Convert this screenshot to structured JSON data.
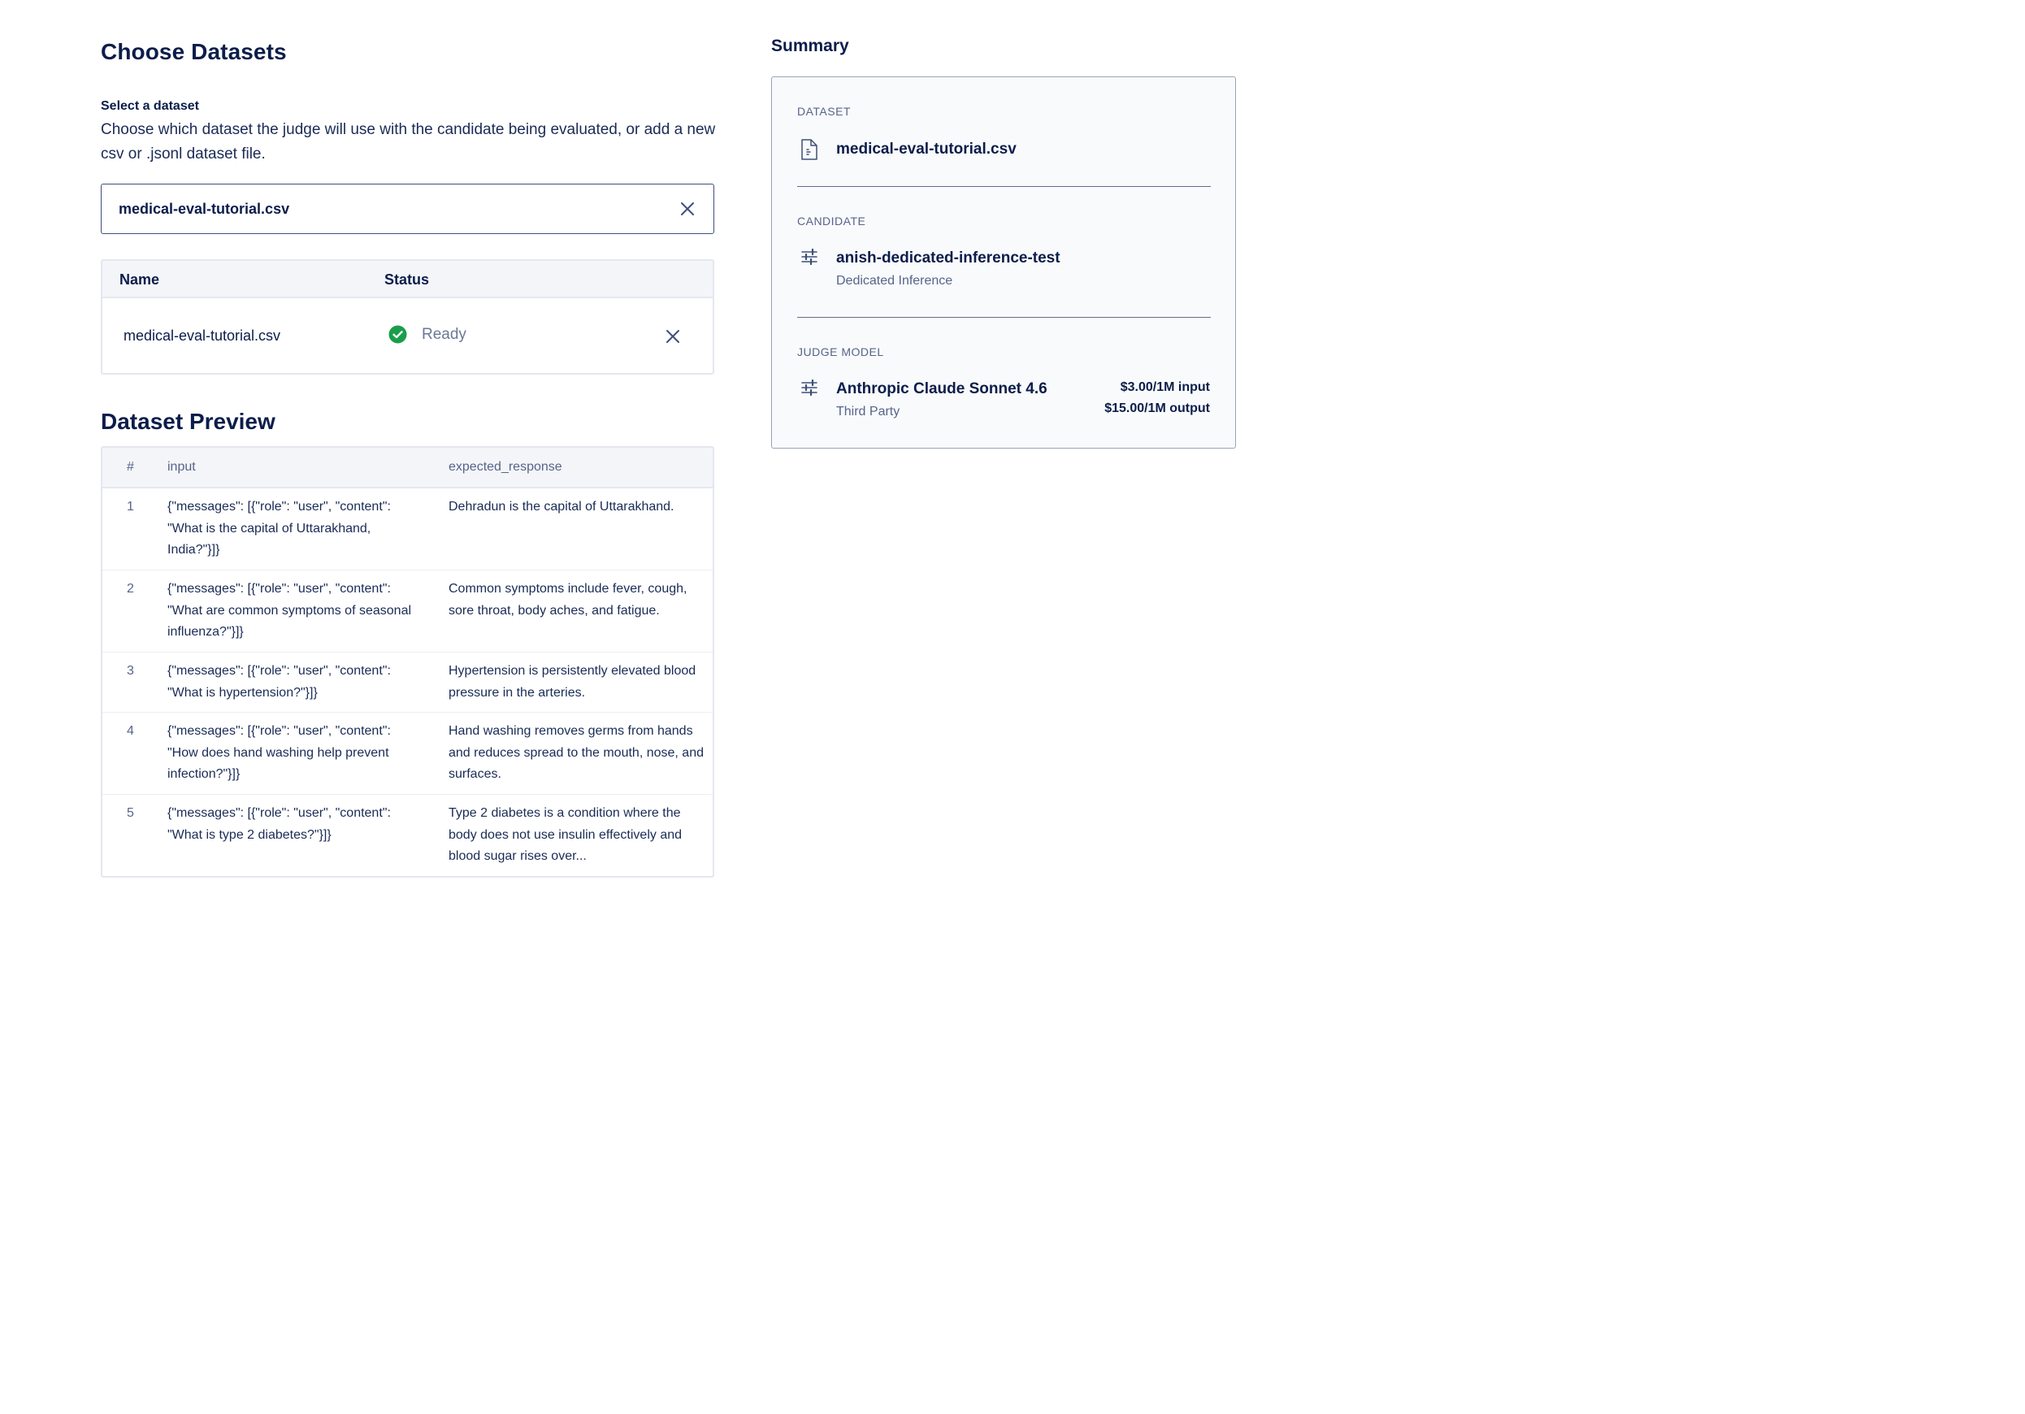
{
  "page_title": "Choose Datasets",
  "select_dataset": {
    "label": "Select a dataset",
    "description": "Choose which dataset the judge will use with the candidate being evaluated, or add a new csv or .jsonl dataset file.",
    "selected_value": "medical-eval-tutorial.csv"
  },
  "files_table": {
    "headers": {
      "name": "Name",
      "status": "Status"
    },
    "rows": [
      {
        "name": "medical-eval-tutorial.csv",
        "status": "Ready"
      }
    ]
  },
  "preview": {
    "title": "Dataset Preview",
    "headers": {
      "num": "#",
      "input": "input",
      "expected": "expected_response"
    },
    "rows": [
      {
        "num": "1",
        "input": "{\"messages\": [{\"role\": \"user\", \"content\": \"What is the capital of Uttarakhand, India?\"}]}",
        "expected": "Dehradun is the capital of Uttarakhand."
      },
      {
        "num": "2",
        "input": "{\"messages\": [{\"role\": \"user\", \"content\": \"What are common symptoms of seasonal influenza?\"}]}",
        "expected": "Common symptoms include fever, cough, sore throat, body aches, and fatigue."
      },
      {
        "num": "3",
        "input": "{\"messages\": [{\"role\": \"user\", \"content\": \"What is hypertension?\"}]}",
        "expected": "Hypertension is persistently elevated blood pressure in the arteries."
      },
      {
        "num": "4",
        "input": "{\"messages\": [{\"role\": \"user\", \"content\": \"How does hand washing help prevent infection?\"}]}",
        "expected": "Hand washing removes germs from hands and reduces spread to the mouth, nose, and surfaces."
      },
      {
        "num": "5",
        "input": "{\"messages\": [{\"role\": \"user\", \"content\": \"What is type 2 diabetes?\"}]}",
        "expected": "Type 2 diabetes is a condition where the body does not use insulin effectively and blood sugar rises over..."
      }
    ]
  },
  "summary": {
    "title": "Summary",
    "dataset": {
      "label": "DATASET",
      "name": "medical-eval-tutorial.csv",
      "icon": "file-icon"
    },
    "candidate": {
      "label": "CANDIDATE",
      "name": "anish-dedicated-inference-test",
      "sub": "Dedicated Inference",
      "icon": "sliders-icon"
    },
    "judge": {
      "label": "JUDGE MODEL",
      "name": "Anthropic Claude Sonnet 4.6",
      "sub": "Third Party",
      "price_input": "$3.00/1M input",
      "price_output": "$15.00/1M output",
      "icon": "sliders-icon"
    }
  },
  "colors": {
    "status_ready": "#1a9e4b",
    "primary_text": "#0b1d4a",
    "muted_text": "#57648a"
  }
}
